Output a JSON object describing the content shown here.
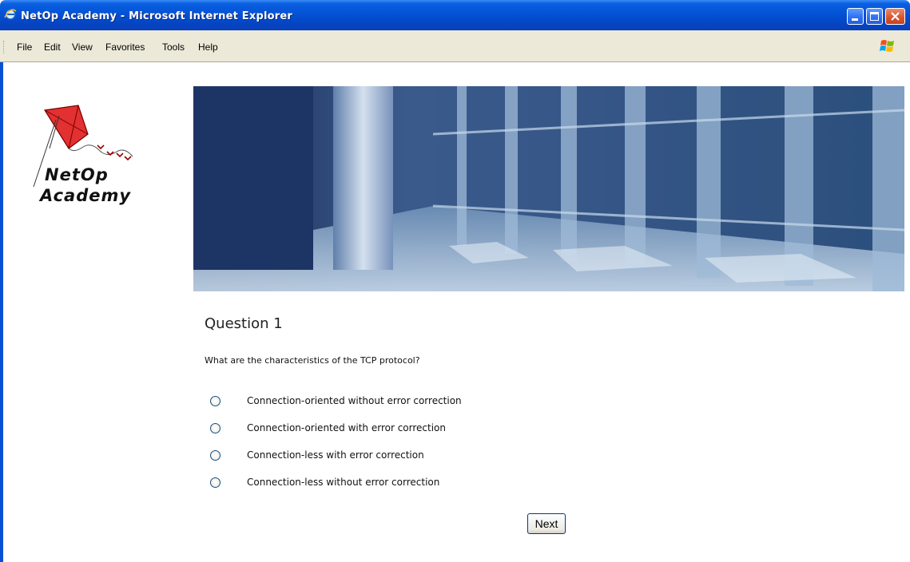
{
  "window": {
    "title": "NetOp Academy  - Microsoft Internet Explorer"
  },
  "menubar": {
    "items": [
      "File",
      "Edit",
      "View",
      "Favorites",
      "Tools",
      "Help"
    ]
  },
  "logo": {
    "line1": "NetOp",
    "line2": "Academy"
  },
  "question": {
    "title": "Question 1",
    "text": "What are the characteristics of the TCP protocol?",
    "options": [
      "Connection-oriented without error correction",
      "Connection-oriented with error correction",
      "Connection-less with error correction",
      "Connection-less without error correction"
    ]
  },
  "next_button": "Next",
  "colors": {
    "titlebar": "#0454d8",
    "menubar": "#ece9d8",
    "close_button": "#d9532d"
  }
}
